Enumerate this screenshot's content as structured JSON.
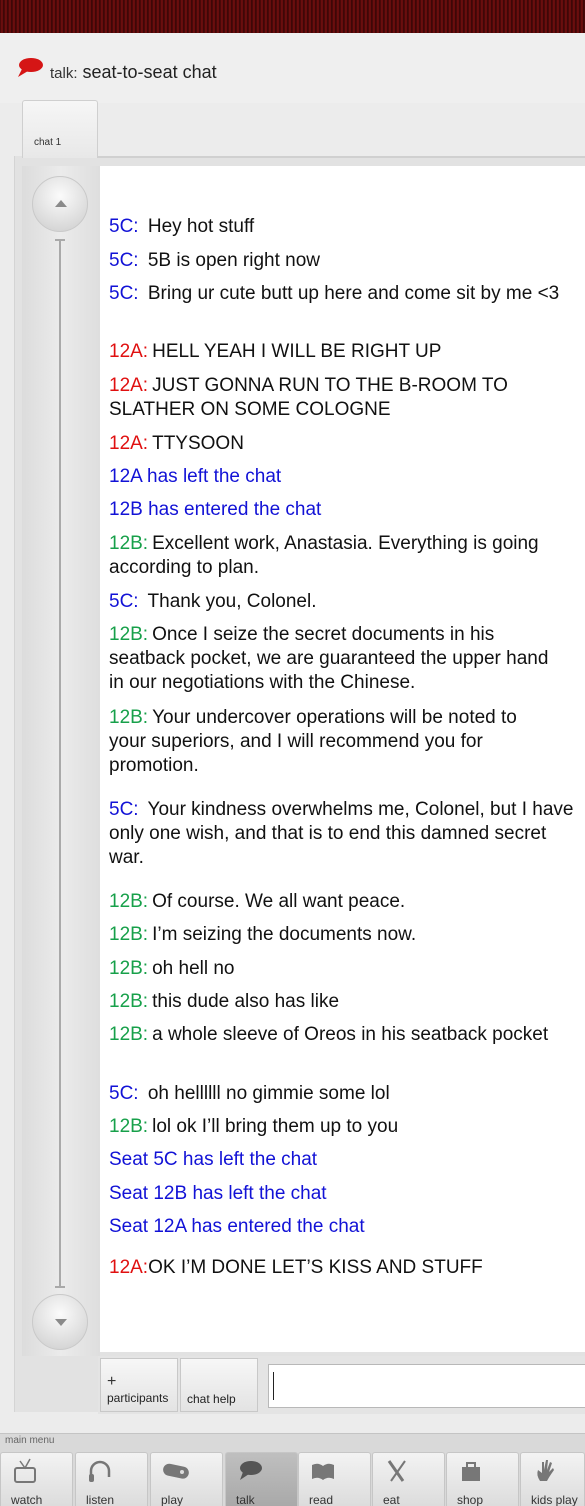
{
  "header": {
    "title_prefix": "talk:",
    "title": "seat-to-seat chat"
  },
  "tabs": [
    {
      "label": "chat 1",
      "active": true
    }
  ],
  "messages": [
    {
      "sender": "5C:",
      "text": "Hey hot stuff",
      "kind": "5C"
    },
    {
      "sender": "5C:",
      "text": "5B is open right now",
      "kind": "5C"
    },
    {
      "sender": "5C:",
      "text": "Bring ur cute butt up here and come sit by me <3",
      "kind": "5C"
    },
    {
      "sender": "12A:",
      "text": "HELL YEAH I WILL BE RIGHT UP",
      "kind": "12A"
    },
    {
      "sender": "12A:",
      "text": "JUST GONNA RUN TO THE B-ROOM TO SLATHER ON SOME COLOGNE",
      "kind": "12A"
    },
    {
      "sender": "12A:",
      "text": "TTYSOON",
      "kind": "12A"
    },
    {
      "sender": "",
      "text": "12A has left the chat",
      "kind": "system"
    },
    {
      "sender": "",
      "text": "12B has entered the chat",
      "kind": "system"
    },
    {
      "sender": "12B:",
      "text": "Excellent work, Anastasia. Everything is going according to plan.",
      "kind": "12B"
    },
    {
      "sender": "5C:",
      "text": "Thank you, Colonel.",
      "kind": "5C"
    },
    {
      "sender": "12B:",
      "text": "Once I seize the secret documents in his seatback pocket, we are guaranteed the upper hand in our negotiations with the Chinese.",
      "kind": "12B"
    },
    {
      "sender": "12B:",
      "text": "Your undercover operations will be noted to your superiors, and I will recommend you for promotion.",
      "kind": "12B"
    },
    {
      "sender": "5C:",
      "text": "Your kindness overwhelms me, Colonel, but I have only one wish, and that is to end this damned secret war.",
      "kind": "5C"
    },
    {
      "sender": "12B:",
      "text": "Of course. We all want peace.",
      "kind": "12B"
    },
    {
      "sender": "12B:",
      "text": "I’m seizing the documents now.",
      "kind": "12B"
    },
    {
      "sender": "12B:",
      "text": "oh hell no",
      "kind": "12B"
    },
    {
      "sender": "12B:",
      "text": "this dude also has like",
      "kind": "12B"
    },
    {
      "sender": "12B:",
      "text": "a whole sleeve of Oreos in his seatback pocket",
      "kind": "12B"
    },
    {
      "sender": "5C:",
      "text": "oh hellllll no gimmie some lol",
      "kind": "5C"
    },
    {
      "sender": "12B:",
      "text": "lol ok I’ll bring them up to you",
      "kind": "12B"
    },
    {
      "sender": "",
      "text": "Seat 5C has left the chat",
      "kind": "system"
    },
    {
      "sender": "",
      "text": "Seat 12B has left the chat",
      "kind": "system"
    },
    {
      "sender": "",
      "text": "Seat 12A has entered the chat",
      "kind": "system"
    },
    {
      "sender": "12A:",
      "text": "OK I’M DONE LET’S KISS AND STUFF",
      "kind": "12A"
    }
  ],
  "actions": {
    "participants_plus": "+",
    "participants_label": "participants",
    "help_label": "chat help"
  },
  "input": {
    "value": ""
  },
  "menu": {
    "label": "main menu",
    "items": [
      {
        "label": "watch",
        "icon": "tv-icon"
      },
      {
        "label": "listen",
        "icon": "headphones-icon"
      },
      {
        "label": "play",
        "icon": "gamepad-icon"
      },
      {
        "label": "talk",
        "icon": "chat-bubble-icon",
        "active": true
      },
      {
        "label": "read",
        "icon": "book-icon"
      },
      {
        "label": "eat",
        "icon": "utensils-icon"
      },
      {
        "label": "shop",
        "icon": "shopping-bag-icon"
      },
      {
        "label": "kids play",
        "icon": "hand-icon"
      }
    ]
  },
  "colors": {
    "seat_5C": "#1212d6",
    "seat_12A": "#e01010",
    "seat_12B": "#17a04a",
    "system": "#1212d6"
  }
}
